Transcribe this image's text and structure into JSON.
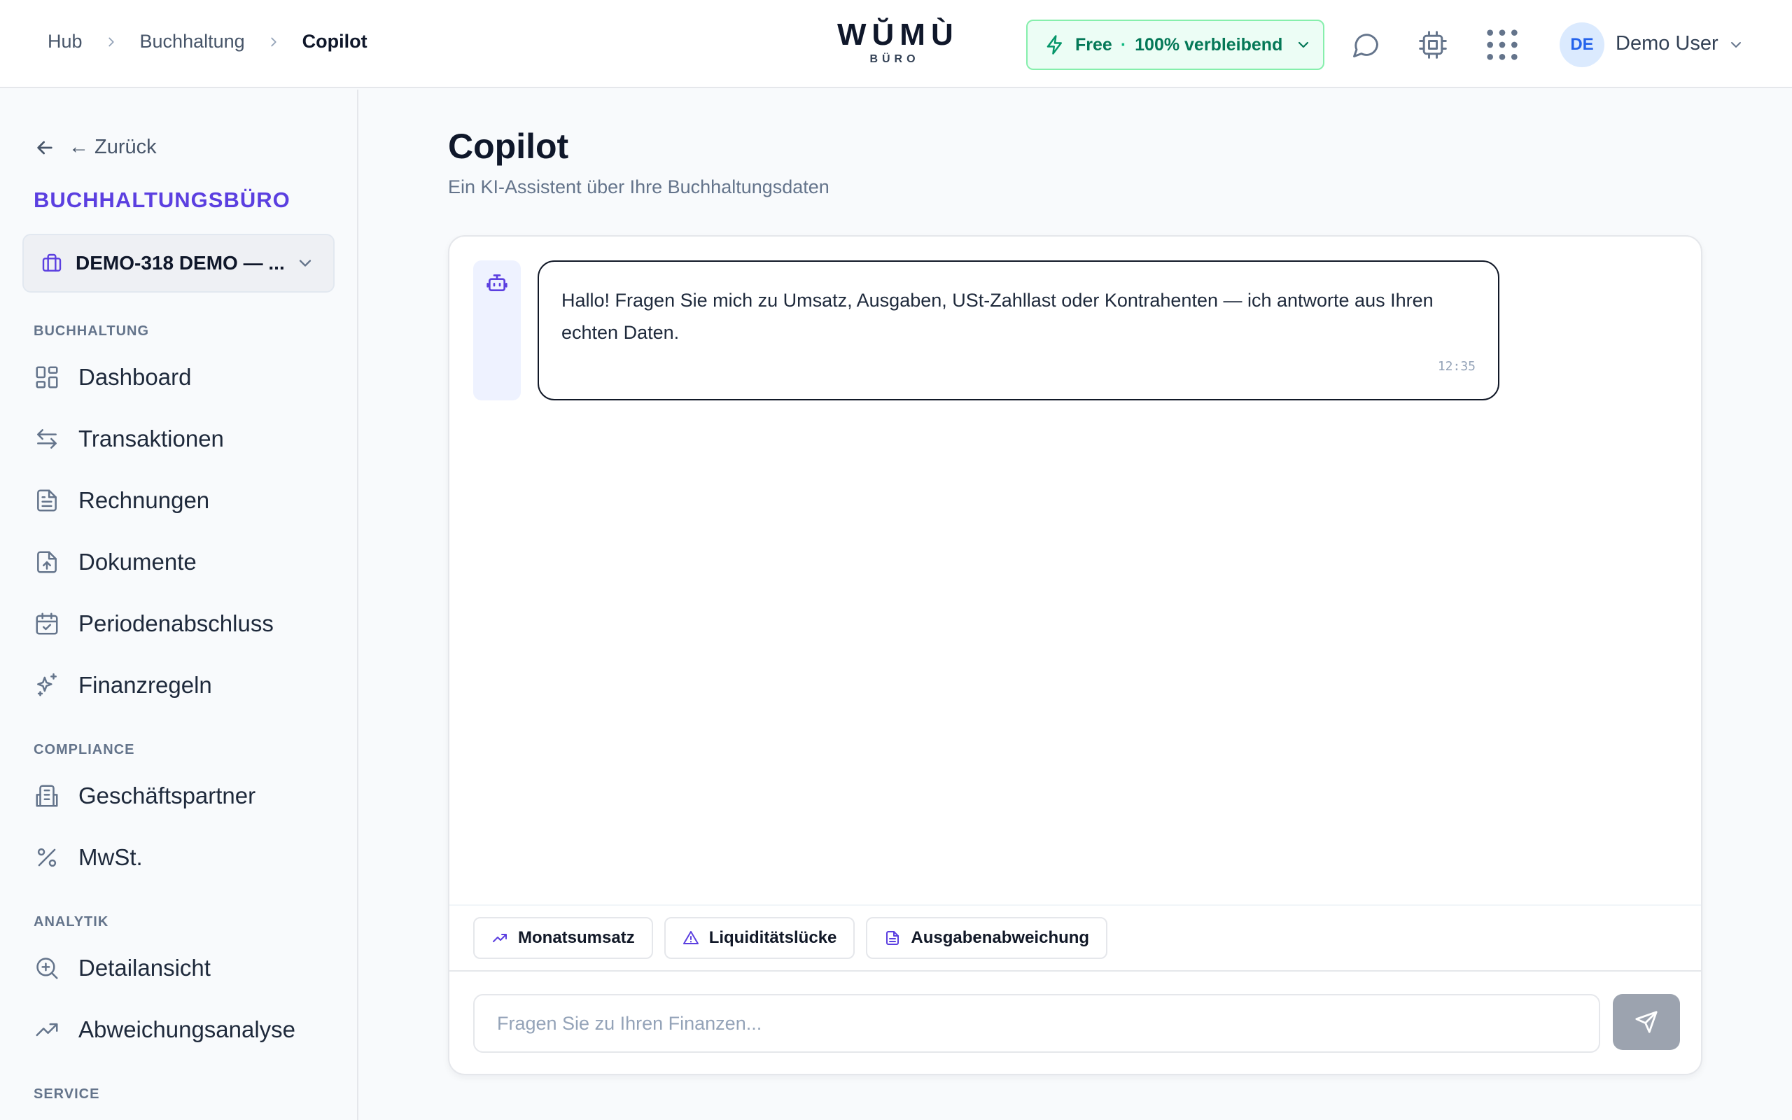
{
  "header": {
    "breadcrumb": [
      "Hub",
      "Buchhaltung",
      "Copilot"
    ],
    "logo": {
      "main": "WŬMÙ",
      "sub": "BÜRO"
    },
    "plan": {
      "name": "Free",
      "separator": "·",
      "remaining": "100% verbleibend"
    },
    "user": {
      "initials": "DE",
      "name": "Demo User"
    }
  },
  "sidebar": {
    "back_label": "← Zurück",
    "brand": "BUCHHALTUNGSBÜRO",
    "tenant": "DEMO-318 DEMO — ...",
    "sections": {
      "buchhaltung": "BUCHHALTUNG",
      "compliance": "COMPLIANCE",
      "analytik": "ANALYTIK",
      "service": "SERVICE"
    },
    "items": [
      {
        "label": "Dashboard",
        "icon": "dashboard-icon"
      },
      {
        "label": "Transaktionen",
        "icon": "arrows-exchange-icon"
      },
      {
        "label": "Rechnungen",
        "icon": "file-text-icon"
      },
      {
        "label": "Dokumente",
        "icon": "file-upload-icon"
      },
      {
        "label": "Periodenabschluss",
        "icon": "calendar-check-icon"
      },
      {
        "label": "Finanzregeln",
        "icon": "sparkles-icon"
      },
      {
        "label": "Geschäftspartner",
        "icon": "building-icon"
      },
      {
        "label": "MwSt.",
        "icon": "percent-icon"
      },
      {
        "label": "Detailansicht",
        "icon": "zoom-in-icon"
      },
      {
        "label": "Abweichungsanalyse",
        "icon": "trending-up-icon"
      }
    ]
  },
  "main": {
    "title": "Copilot",
    "subtitle": "Ein KI-Assistent über Ihre Buchhaltungsdaten",
    "messages": [
      {
        "role": "assistant",
        "text": "Hallo! Fragen Sie mich zu Umsatz, Ausgaben, USt-Zahllast oder Kontrahenten — ich antworte aus Ihren echten Daten.",
        "time": "12:35"
      }
    ],
    "suggestions": [
      {
        "label": "Monatsumsatz",
        "icon": "trending-up-icon"
      },
      {
        "label": "Liquiditätslücke",
        "icon": "warning-triangle-icon"
      },
      {
        "label": "Ausgabenabweichung",
        "icon": "file-text-icon"
      }
    ],
    "input": {
      "placeholder": "Fragen Sie zu Ihren Finanzen...",
      "value": ""
    }
  },
  "colors": {
    "brand": "#5b3fe0",
    "plan_bg": "#ecfdf5",
    "plan_border": "#86efac",
    "plan_text": "#047857",
    "send_button": "#9ca3af",
    "avatar_bg": "#dbeafe"
  }
}
